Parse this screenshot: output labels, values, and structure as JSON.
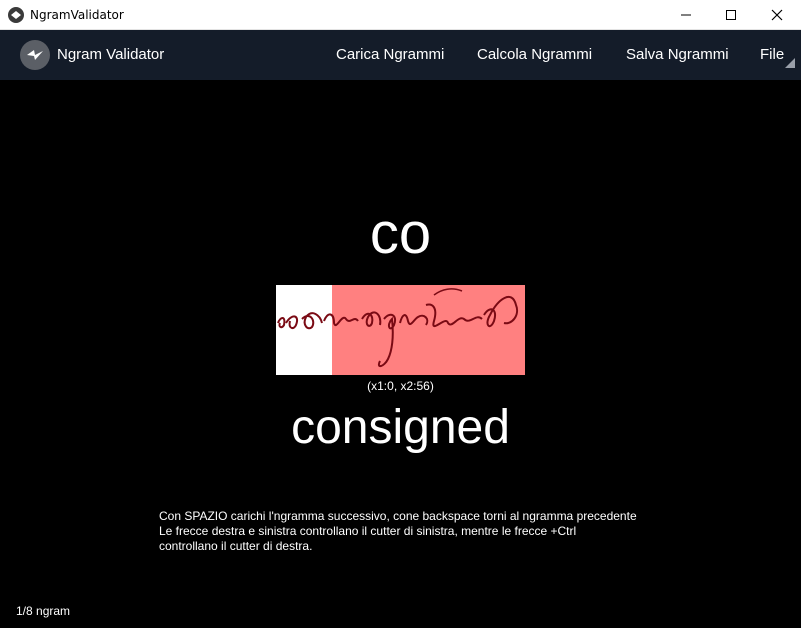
{
  "window": {
    "title": "NgramValidator"
  },
  "menubar": {
    "brand": "Ngram Validator",
    "items": [
      "Carica Ngrammi",
      "Calcola Ngrammi",
      "Salva Ngrammi",
      "File"
    ]
  },
  "main": {
    "ngram": "co",
    "coords": "(x1:0, x2:56)",
    "word": "consigned",
    "help_lines": [
      "Con SPAZIO carichi l'ngramma successivo, cone backspace torni al ngramma precedente",
      "Le frecce destra e sinistra controllano il cutter di sinistra, mentre le frecce +Ctrl",
      "controllano il cutter di destra."
    ]
  },
  "status": "1/8 ngram",
  "colors": {
    "menubar": "#141c29",
    "selection": "#ff8080",
    "ink": "#7a0a14"
  },
  "icons": [
    "app-icon",
    "minimize-icon",
    "maximize-icon",
    "close-icon",
    "brand-logo",
    "corner-arrow-icon"
  ]
}
